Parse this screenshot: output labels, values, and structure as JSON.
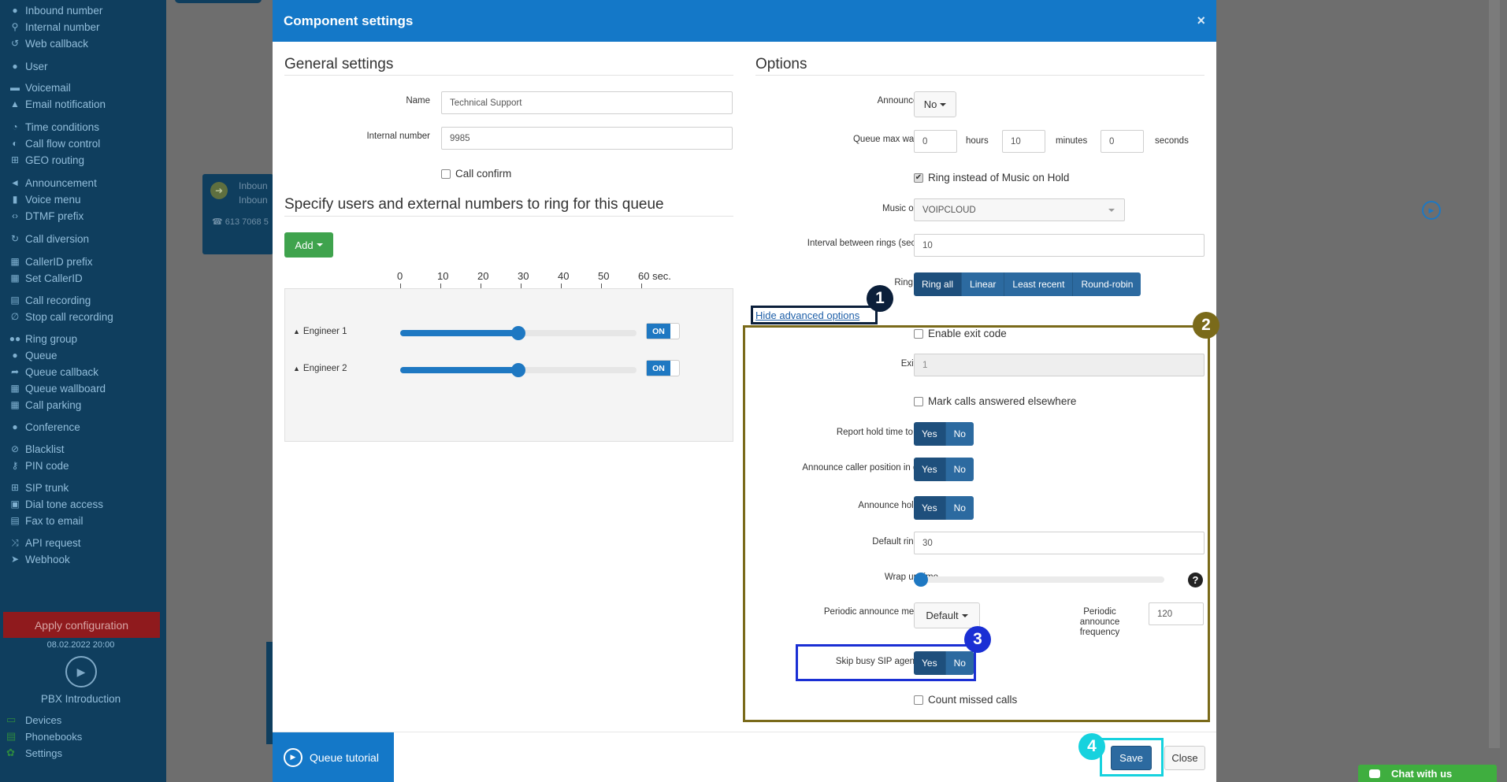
{
  "sidebar": {
    "items": [
      {
        "label": "Inbound number",
        "icon": "circle-icon"
      },
      {
        "label": "Internal number",
        "icon": "pin-icon"
      },
      {
        "label": "Web callback",
        "icon": "history-icon"
      },
      {
        "label": "User",
        "icon": "user-icon"
      },
      {
        "label": "Voicemail",
        "icon": "voicemail-icon"
      },
      {
        "label": "Email notification",
        "icon": "bell-icon"
      },
      {
        "label": "Time conditions",
        "icon": "clock-icon"
      },
      {
        "label": "Call flow control",
        "icon": "toggle-icon"
      },
      {
        "label": "GEO routing",
        "icon": "sitemap-icon"
      },
      {
        "label": "Announcement",
        "icon": "megaphone-icon"
      },
      {
        "label": "Voice menu",
        "icon": "microphone-icon"
      },
      {
        "label": "DTMF prefix",
        "icon": "code-icon"
      },
      {
        "label": "Call diversion",
        "icon": "refresh-icon"
      },
      {
        "label": "CallerID prefix",
        "icon": "table-icon"
      },
      {
        "label": "Set CallerID",
        "icon": "grid-icon"
      },
      {
        "label": "Call recording",
        "icon": "record-icon"
      },
      {
        "label": "Stop call recording",
        "icon": "no-mic-icon"
      },
      {
        "label": "Ring group",
        "icon": "users-icon"
      },
      {
        "label": "Queue",
        "icon": "queue-icon"
      },
      {
        "label": "Queue callback",
        "icon": "share-icon"
      },
      {
        "label": "Queue wallboard",
        "icon": "board-icon"
      },
      {
        "label": "Call parking",
        "icon": "parking-icon"
      },
      {
        "label": "Conference",
        "icon": "chat-icon"
      },
      {
        "label": "Blacklist",
        "icon": "ban-icon"
      },
      {
        "label": "PIN code",
        "icon": "key-icon"
      },
      {
        "label": "SIP trunk",
        "icon": "sitemap-icon"
      },
      {
        "label": "Dial tone access",
        "icon": "lock-icon"
      },
      {
        "label": "Fax to email",
        "icon": "fax-icon"
      },
      {
        "label": "API request",
        "icon": "random-icon"
      },
      {
        "label": "Webhook",
        "icon": "send-icon"
      }
    ],
    "apply_label": "Apply configuration",
    "apply_date": "08.02.2022 20:00",
    "intro_label": "PBX Introduction",
    "bottom": [
      {
        "label": "Devices",
        "icon": "monitor-icon"
      },
      {
        "label": "Phonebooks",
        "icon": "book-icon"
      },
      {
        "label": "Settings",
        "icon": "gear-icon"
      }
    ]
  },
  "background_node": {
    "line1": "Inboun",
    "line2": "Inboun",
    "phone": "613 7068 5"
  },
  "modal": {
    "title": "Component settings",
    "close_glyph": "×",
    "general": {
      "title": "General settings",
      "name_label": "Name",
      "name_value": "Technical Support",
      "internal_label": "Internal number",
      "internal_value": "9985",
      "call_confirm_label": "Call confirm"
    },
    "users_section": {
      "title": "Specify users and external numbers to ring for this queue",
      "add_label": "Add",
      "scale": [
        "0",
        "10",
        "20",
        "30",
        "40",
        "50",
        "60 sec."
      ],
      "users": [
        {
          "name": "Engineer 1",
          "ring_seconds": 30,
          "toggle": "ON"
        },
        {
          "name": "Engineer 2",
          "ring_seconds": 30,
          "toggle": "ON"
        }
      ]
    },
    "options": {
      "title": "Options",
      "announcement_label": "Announcement",
      "announcement_value": "No",
      "max_wait_label": "Queue max wait time",
      "hours_value": "0",
      "hours_unit": "hours",
      "minutes_value": "10",
      "minutes_unit": "minutes",
      "seconds_value": "0",
      "seconds_unit": "seconds",
      "ring_instead_label": "Ring instead of Music on Hold",
      "moh_label": "Music on hold",
      "moh_value": "VOIPCLOUD",
      "interval_label": "Interval between rings (seconds)",
      "interval_value": "10",
      "ring_mode_label": "Ring mode",
      "ring_modes": [
        "Ring all",
        "Linear",
        "Least recent",
        "Round-robin"
      ],
      "hide_advanced": "Hide advanced options",
      "enable_exit_label": "Enable exit code",
      "exit_code_label": "Exit code",
      "exit_code_value": "1",
      "mark_calls_label": "Mark calls answered elsewhere",
      "report_hold_label": "Report hold time to agent",
      "announce_position_label": "Announce caller position in queue",
      "announce_hold_label": "Announce hold time",
      "yes": "Yes",
      "no": "No",
      "default_ring_label": "Default ring time",
      "default_ring_value": "30",
      "wrap_up_label": "Wrap up time",
      "wrap_up_level": 0,
      "periodic_msg_label": "Periodic announce message",
      "periodic_msg_value": "Default",
      "periodic_freq_label": "Periodic announce frequency",
      "periodic_freq_value": "120",
      "skip_busy_label": "Skip busy SIP agents",
      "count_missed_label": "Count missed calls"
    },
    "footer": {
      "tutorial_label": "Queue tutorial",
      "save_label": "Save",
      "close_label": "Close"
    }
  },
  "annotations": [
    {
      "number": "1",
      "color": "#0b1f3a"
    },
    {
      "number": "2",
      "color": "#7a6a1a"
    },
    {
      "number": "3",
      "color": "#1a2fd4"
    },
    {
      "number": "4",
      "color": "#16d2de"
    }
  ],
  "chat": {
    "label": "Chat with us"
  }
}
